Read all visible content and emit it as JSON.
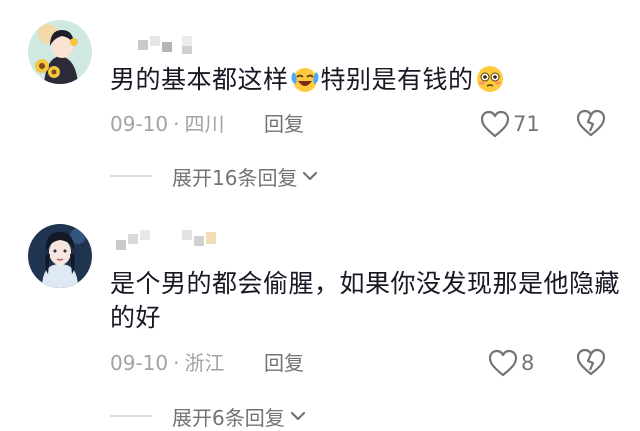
{
  "comments": [
    {
      "text_a": "男的基本都这样",
      "text_b": "特别是有钱的",
      "date": "09-10",
      "separator": "·",
      "location": "四川",
      "reply_label": "回复",
      "like_count": "71",
      "expand_label": "展开16条回复",
      "avatar_icon": "avatar-girl-sunflower",
      "emoji_1": "laughing-crying-emoji",
      "emoji_2": "flushed-face-emoji"
    },
    {
      "text_a": "是个男的都会偷腥，如果你没发现那是他隐藏的好",
      "date": "09-10",
      "separator": "·",
      "location": "浙江",
      "reply_label": "回复",
      "like_count": "8",
      "expand_label": "展开6条回复",
      "avatar_icon": "avatar-woman-portrait"
    }
  ],
  "colors": {
    "text": "#161823",
    "meta": "#a3a3a6",
    "action": "#737373",
    "icon": "#73737a"
  }
}
